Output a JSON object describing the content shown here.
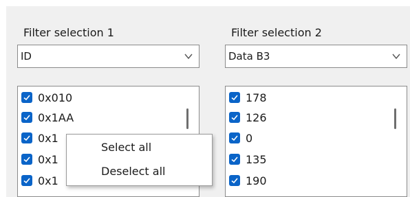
{
  "filter1": {
    "label": "Filter selection 1",
    "selected": "ID",
    "items": [
      {
        "text": "0x010",
        "checked": true
      },
      {
        "text": "0x1AA",
        "checked": true
      },
      {
        "text": "0x1",
        "checked": true
      },
      {
        "text": "0x1",
        "checked": true
      },
      {
        "text": "0x1",
        "checked": true
      }
    ]
  },
  "filter2": {
    "label": "Filter selection 2",
    "selected": "Data B3",
    "items": [
      {
        "text": "178",
        "checked": true
      },
      {
        "text": "126",
        "checked": true
      },
      {
        "text": "0",
        "checked": true
      },
      {
        "text": "135",
        "checked": true
      },
      {
        "text": "190",
        "checked": true
      }
    ]
  },
  "context_menu": {
    "items": [
      {
        "label": "Select all"
      },
      {
        "label": "Deselect all"
      }
    ]
  },
  "icons": {
    "dropdown": "chevron-down-icon",
    "checkbox": "checkmark-icon"
  },
  "colors": {
    "background": "#f0f0f0",
    "checkbox_accent": "#0a64c8",
    "border": "#8a8a8a"
  }
}
